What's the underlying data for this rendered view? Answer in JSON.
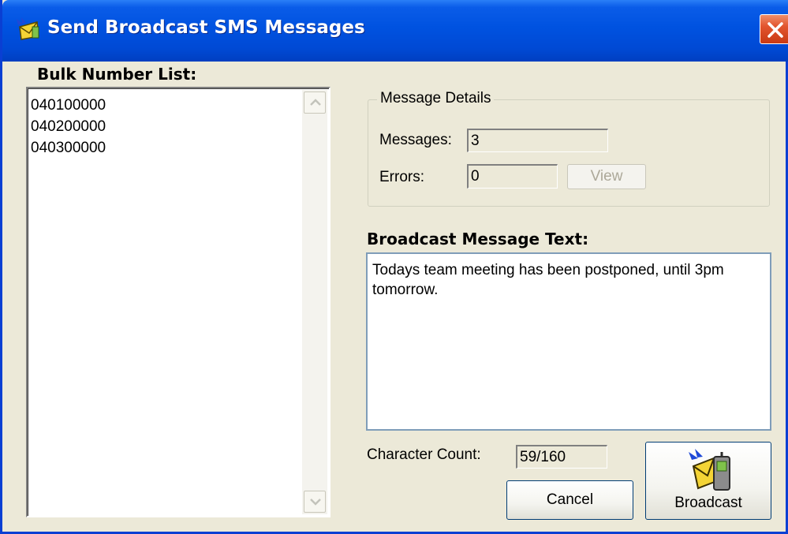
{
  "window": {
    "title": "Send Broadcast SMS Messages",
    "app_icon": "envelope-broadcast-icon",
    "close_icon": "close-icon"
  },
  "bulk_list": {
    "label": "Bulk Number List:",
    "numbers": [
      "040100000",
      "040200000",
      "040300000"
    ]
  },
  "message_details": {
    "legend": "Message Details",
    "messages_label": "Messages:",
    "messages_value": "3",
    "errors_label": "Errors:",
    "errors_value": "0",
    "view_label": "View"
  },
  "broadcast_text": {
    "label": "Broadcast Message Text:",
    "value": "Todays team meeting has been postponed, until 3pm\ntomorrow."
  },
  "char_count": {
    "label": "Character Count:",
    "value": "59/160"
  },
  "buttons": {
    "cancel": "Cancel",
    "broadcast": "Broadcast",
    "broadcast_icon": "phone-envelope-icon"
  },
  "colors": {
    "titlebar": "#0052e0",
    "face": "#ece9d8",
    "close": "#e2552e"
  }
}
